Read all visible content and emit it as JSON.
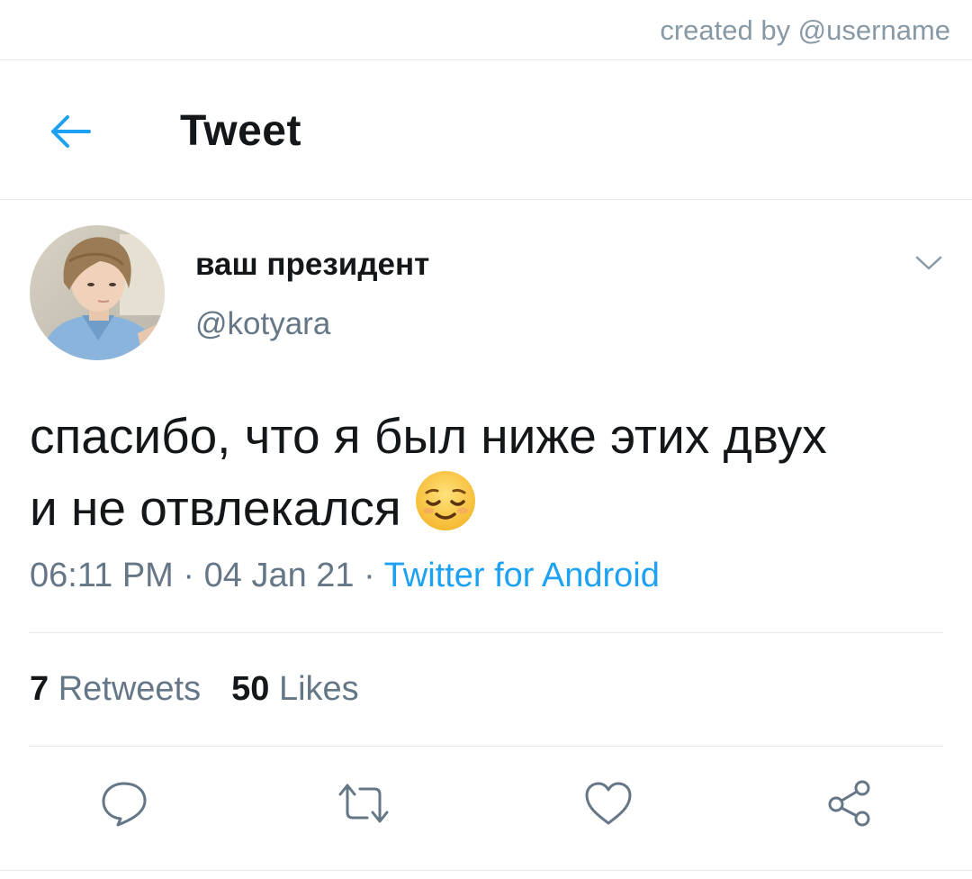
{
  "watermark": "created by @username",
  "header": {
    "title": "Tweet",
    "back_icon": "arrow-left-icon"
  },
  "tweet": {
    "author": {
      "display_name": "ваш президент",
      "handle": "@kotyara",
      "avatar": "avatar-photo"
    },
    "text_lines": [
      "спасибо, что я был ниже этих двух",
      "и не  отвлекался"
    ],
    "emoji": "relieved-face-emoji",
    "time": "06:11 PM",
    "date": "04 Jan 21",
    "separator": " · ",
    "source": "Twitter for Android",
    "stats": {
      "retweets_count": "7",
      "retweets_label": "Retweets",
      "likes_count": "50",
      "likes_label": "Likes"
    }
  },
  "actions": [
    {
      "name": "reply",
      "icon": "reply-icon"
    },
    {
      "name": "retweet",
      "icon": "retweet-icon"
    },
    {
      "name": "like",
      "icon": "heart-icon"
    },
    {
      "name": "share",
      "icon": "share-icon"
    }
  ],
  "colors": {
    "accent": "#1da1f2",
    "text": "#14171a",
    "secondary": "#657786",
    "border": "#e1e8ed",
    "icon": "#657786"
  }
}
